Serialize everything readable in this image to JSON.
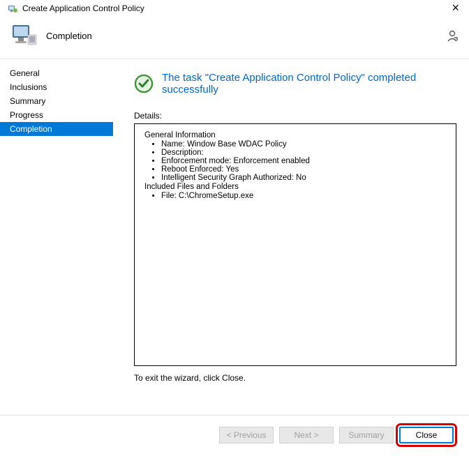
{
  "titlebar": {
    "text": "Create Application Control Policy"
  },
  "close_x": "×",
  "header": {
    "title": "Completion"
  },
  "sidebar": {
    "items": [
      {
        "label": "General"
      },
      {
        "label": "Inclusions"
      },
      {
        "label": "Summary"
      },
      {
        "label": "Progress"
      },
      {
        "label": "Completion"
      }
    ],
    "selected_index": 4
  },
  "main": {
    "success_text": "The task \"Create Application Control Policy\" completed successfully",
    "details_label": "Details:",
    "details": {
      "general_heading": "General Information",
      "general_items": [
        "Name: Window Base WDAC Policy",
        "Description:",
        "Enforcement mode: Enforcement enabled",
        "Reboot Enforced: Yes",
        "Intelligent Security Graph Authorized: No"
      ],
      "included_heading": "Included Files and Folders",
      "included_items": [
        "File: C:\\ChromeSetup.exe"
      ]
    },
    "exit_text": "To exit the wizard, click Close."
  },
  "buttons": {
    "previous": "< Previous",
    "next": "Next >",
    "summary": "Summary",
    "close": "Close"
  }
}
